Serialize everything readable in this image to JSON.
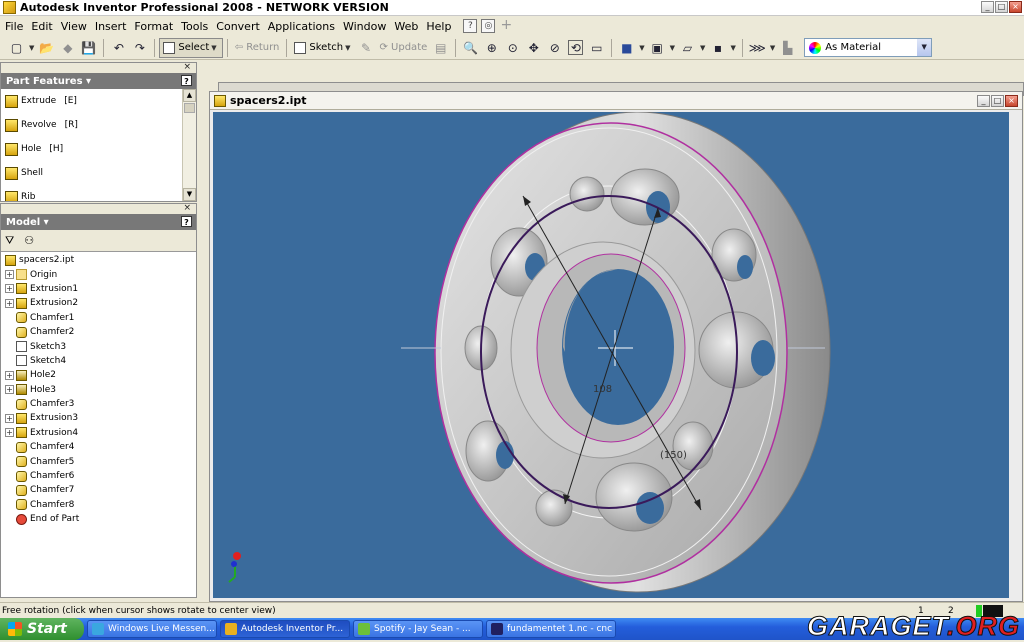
{
  "window": {
    "title": "Autodesk Inventor Professional 2008 - NETWORK VERSION"
  },
  "menu": [
    "File",
    "Edit",
    "View",
    "Insert",
    "Format",
    "Tools",
    "Convert",
    "Applications",
    "Window",
    "Web",
    "Help"
  ],
  "toolbar": {
    "select_label": "Select",
    "return_label": "Return",
    "sketch_label": "Sketch",
    "update_label": "Update",
    "material_value": "As Material"
  },
  "part_features": {
    "title": "Part Features",
    "items": [
      {
        "label": "Extrude",
        "key": "[E]"
      },
      {
        "label": "Revolve",
        "key": "[R]"
      },
      {
        "label": "Hole",
        "key": "[H]"
      },
      {
        "label": "Shell",
        "key": ""
      },
      {
        "label": "Rib",
        "key": ""
      }
    ]
  },
  "model": {
    "title": "Model",
    "root": "spacers2.ipt",
    "items": [
      {
        "label": "Origin",
        "type": "folder",
        "exp": true
      },
      {
        "label": "Extrusion1",
        "type": "extrude",
        "exp": true
      },
      {
        "label": "Extrusion2",
        "type": "extrude",
        "exp": true
      },
      {
        "label": "Chamfer1",
        "type": "chamfer",
        "exp": false
      },
      {
        "label": "Chamfer2",
        "type": "chamfer",
        "exp": false
      },
      {
        "label": "Sketch3",
        "type": "sketch",
        "exp": false
      },
      {
        "label": "Sketch4",
        "type": "sketch",
        "exp": false
      },
      {
        "label": "Hole2",
        "type": "hole",
        "exp": true
      },
      {
        "label": "Hole3",
        "type": "hole",
        "exp": true
      },
      {
        "label": "Chamfer3",
        "type": "chamfer",
        "exp": false
      },
      {
        "label": "Extrusion3",
        "type": "extrude",
        "exp": true
      },
      {
        "label": "Extrusion4",
        "type": "extrude",
        "exp": true
      },
      {
        "label": "Chamfer4",
        "type": "chamfer",
        "exp": false
      },
      {
        "label": "Chamfer5",
        "type": "chamfer",
        "exp": false
      },
      {
        "label": "Chamfer6",
        "type": "chamfer",
        "exp": false
      },
      {
        "label": "Chamfer7",
        "type": "chamfer",
        "exp": false
      },
      {
        "label": "Chamfer8",
        "type": "chamfer",
        "exp": false
      },
      {
        "label": "End of Part",
        "type": "end",
        "exp": false
      }
    ]
  },
  "document": {
    "title": "spacers2.ipt",
    "dim_inner": "108",
    "dim_outer": "(150)"
  },
  "status": {
    "text": "Free rotation (click when cursor shows rotate to center view)",
    "n1": "1",
    "n2": "2"
  },
  "taskbar": {
    "start": "Start",
    "tasks": [
      {
        "label": "Windows Live Messen...",
        "color": "#3aa7e0"
      },
      {
        "label": "Autodesk Inventor Pr...",
        "color": "#e8b020"
      },
      {
        "label": "Spotify - Jay Sean - ...",
        "color": "#6cbf3a"
      },
      {
        "label": "fundamentet 1.nc - cnc",
        "color": "#202060"
      }
    ]
  },
  "watermark": {
    "main": "GARAGET",
    "suffix": ".ORG"
  },
  "colors": {
    "viewport": "#3a6b9c",
    "accent": "#245edb"
  }
}
